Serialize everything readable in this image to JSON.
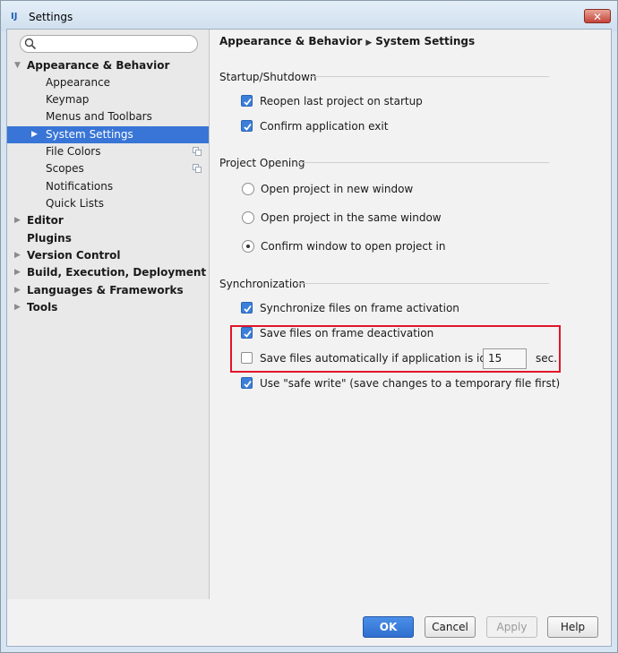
{
  "window": {
    "title": "Settings",
    "close_label": "✕"
  },
  "search": {
    "placeholder": "",
    "value": ""
  },
  "sidebar": {
    "items": [
      {
        "label": "Appearance & Behavior",
        "expanded": true
      },
      {
        "label": "Appearance"
      },
      {
        "label": "Keymap"
      },
      {
        "label": "Menus and Toolbars"
      },
      {
        "label": "System Settings",
        "selected": true
      },
      {
        "label": "File Colors"
      },
      {
        "label": "Scopes"
      },
      {
        "label": "Notifications"
      },
      {
        "label": "Quick Lists"
      },
      {
        "label": "Editor"
      },
      {
        "label": "Plugins"
      },
      {
        "label": "Version Control"
      },
      {
        "label": "Build, Execution, Deployment"
      },
      {
        "label": "Languages & Frameworks"
      },
      {
        "label": "Tools"
      }
    ]
  },
  "breadcrumb": {
    "parent": "Appearance & Behavior",
    "current": "System Settings"
  },
  "startup": {
    "title": "Startup/Shutdown",
    "reopen": {
      "label": "Reopen last project on startup",
      "checked": true
    },
    "confirm_exit": {
      "label": "Confirm application exit",
      "checked": true
    }
  },
  "project_opening": {
    "title": "Project Opening",
    "options": [
      {
        "label": "Open project in new window",
        "selected": false
      },
      {
        "label": "Open project in the same window",
        "selected": false
      },
      {
        "label": "Confirm window to open project in",
        "selected": true
      }
    ]
  },
  "sync": {
    "title": "Synchronization",
    "sync_on_activation": {
      "label": "Synchronize files on frame activation",
      "checked": true
    },
    "save_on_deactivation": {
      "label": "Save files on frame deactivation",
      "checked": true
    },
    "save_on_idle": {
      "label": "Save files automatically if application is idle for",
      "checked": false,
      "seconds": "15",
      "unit": "sec."
    },
    "safe_write": {
      "label": "Use \"safe write\" (save changes to a temporary file first)",
      "checked": true
    }
  },
  "buttons": {
    "ok": "OK",
    "cancel": "Cancel",
    "apply": "Apply",
    "help": "Help"
  },
  "colors": {
    "selection": "#3875d6",
    "checkbox": "#3b7fd9",
    "highlight_border": "#e0152a",
    "primary_button": "#2f6fd0"
  }
}
